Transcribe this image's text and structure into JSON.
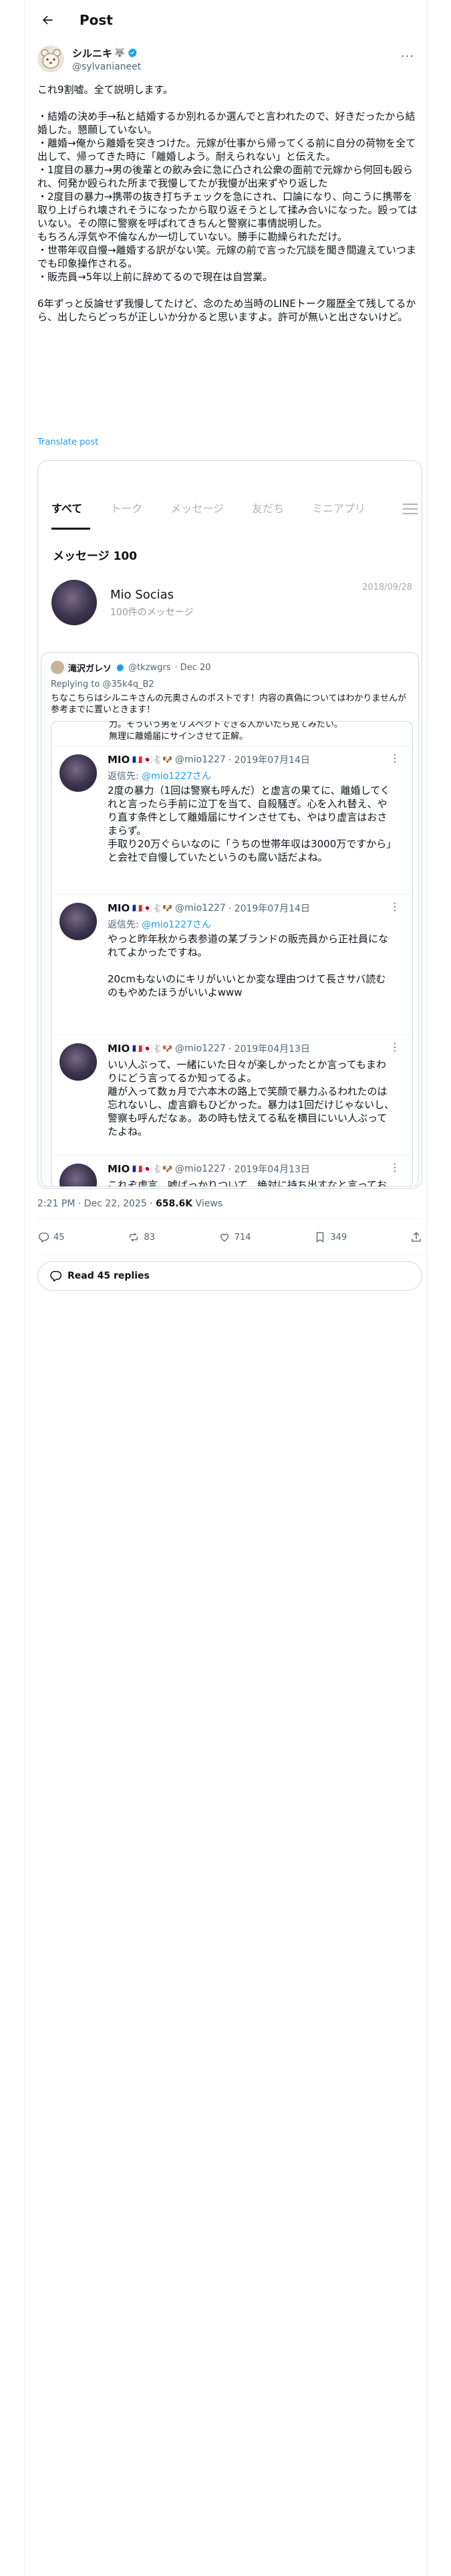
{
  "header": {
    "title": "Post"
  },
  "author": {
    "name": "シルニキ",
    "emoji": "🐺",
    "handle": "@sylvanianeet"
  },
  "tweet": {
    "text": "これ9割嘘。全て説明します。\n\n・結婚の決め手→私と結婚するか別れるか選んでと言われたので、好きだったから結婚した。懇願していない。\n・離婚→俺から離婚を突きつけた。元嫁が仕事から帰ってくる前に自分の荷物を全て出して、帰ってきた時に「離婚しよう。耐えられない」と伝えた。\n・1度目の暴力→男の後輩との飲み会に急に凸され公衆の面前で元嫁から何回も殴られ、何発か殴られた所まで我慢してたが我慢が出来ずやり返した\n・2度目の暴力→携帯の抜き打ちチェックを急にされ、口論になり、向こうに携帯を取り上げられ壊されそうになったから取り返そうとして揉み合いになった。殴ってはいない。その際に警察を呼ばれてきちんと警察に事情説明した。\nもちろん浮気や不倫なんか一切していない。勝手に勘繰られただけ。\n・世帯年収自慢→離婚する訳がない笑。元嫁の前で言った冗談を聞き間違えていつまでも印象操作される。\n・販売員→5年以上前に辞めてるので現在は自営業。\n\n6年ずっと反論せず我慢してたけど、念のため当時のLINEトーク履歴全て残してるから、出したらどっちが正しいか分かると思いますよ。許可が無いと出さないけど。",
    "translate": "Translate post"
  },
  "line_screenshot": {
    "tabs": [
      "すべて",
      "トーク",
      "メッセージ",
      "友だち",
      "ミニアプリ"
    ],
    "message_count": "メッセージ 100",
    "chat": {
      "name": "Mio Socias",
      "sub": "100件のメッセージ",
      "date": "2018/09/28"
    }
  },
  "quoted": {
    "name": "滝沢ガレソ",
    "handle": "@tkzwgrs",
    "date": "· Dec 20",
    "replying": "Replying to @35k4q_B2",
    "body": "ちなこちらはシルニキさんの元奥さんのポストです！内容の真偽についてはわかりませんが参考までに置いときます！",
    "inner_top": "力。そういう男をリスペクトできる人がいたら見てみたい。\n無理に離婚届にサインさせて正解。",
    "replies": [
      {
        "name": "MIO",
        "flags": "🇫🇷🇯🇵🐇🐶",
        "handle": "@mio1227",
        "date": "· 2019年07月14日",
        "reply_to_label": "返信先: ",
        "reply_to": "@mio1227さん",
        "text": "2度の暴力（1回は警察も呼んだ）と虚言の果てに、離婚してくれと言ったら手前に泣丁を当て、自殺騒ぎ。心を入れ替え、やり直す条件として離婚届にサインさせても、やはり虚言はおさまらず。\n手取り20万ぐらいなのに「うちの世帯年収は3000万ですから」と会社で自慢していたというのも腐い話だよね。"
      },
      {
        "name": "MIO",
        "flags": "🇫🇷🇯🇵🐇🐶",
        "handle": "@mio1227",
        "date": "· 2019年07月14日",
        "reply_to_label": "返信先: ",
        "reply_to": "@mio1227さん",
        "text": "やっと昨年秋から表参道の某ブランドの販売員から正社員になれてよかったですね。\n\n20cmもないのにキリがいいとか変な理由つけて長さサバ読むのもやめたほうがいいよwww"
      },
      {
        "name": "MIO",
        "flags": "🇫🇷🇯🇵🐇🐶",
        "handle": "@mio1227",
        "date": "· 2019年04月13日",
        "reply_to_label": "",
        "reply_to": "",
        "text": "いい人ぶって、一緒にいた日々が楽しかったとか言ってもまわりにどう言ってるか知ってるよ。\n離が入って数ヵ月で六本木の路上で笑顔で暴力ふるわれたのは忘れないし、虚言癖もひどかった。暴力は1回だけじゃないし、警察も呼んだなぁ。あの時も怯えてる私を横目にいい人ぶってたよね。"
      },
      {
        "name": "MIO",
        "flags": "🇫🇷🇯🇵🐇🐶",
        "handle": "@mio1227",
        "date": "· 2019年04月13日",
        "reply_to_label": "",
        "reply_to": "",
        "text": "これぞ虚言。嘘ばっかりついて、絶対に持ち出すなと言っておいた私の荷物を手に取って、結婚指輪を外し『Sagittarius』の"
      }
    ]
  },
  "meta": {
    "time": "2:21 PM · Dec 22, 2025 · ",
    "views": "658.6K",
    "views_label": " Views"
  },
  "actions": {
    "replies": "45",
    "reposts": "83",
    "likes": "714",
    "bookmarks": "349"
  },
  "read_replies": "Read 45 replies"
}
